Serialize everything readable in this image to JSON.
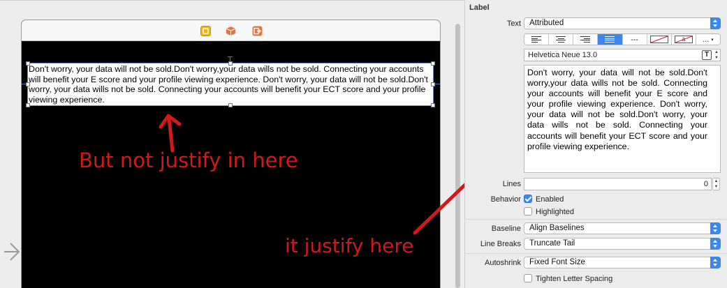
{
  "canvas": {
    "label_text": "Don't worry, your data will not be sold.Don't worry,your data wills not be sold. Connecting your accounts will benefit your E score and your profile viewing experience. Don't worry, your data will not be sold.Don't worry, your data wills not be sold. Connecting your accounts will benefit your ECT score and your profile viewing experience.",
    "annotation_left": "But not justify in here",
    "annotation_right": "it justify here"
  },
  "inspector": {
    "section_title": "Label",
    "text": {
      "label": "Text",
      "value": "Attributed"
    },
    "alignment_segments": [
      {
        "name": "align-left",
        "active": false
      },
      {
        "name": "align-center",
        "active": false
      },
      {
        "name": "align-right",
        "active": false
      },
      {
        "name": "align-justify",
        "active": true
      },
      {
        "name": "align-natural",
        "active": false,
        "glyph": "---"
      },
      {
        "name": "strikethrough",
        "active": false
      },
      {
        "name": "highlight",
        "active": false,
        "glyph": "a"
      },
      {
        "name": "more",
        "active": false,
        "glyph": "..."
      }
    ],
    "font": {
      "value": "Helvetica Neue 13.0",
      "button": "T"
    },
    "attributed_text": "Don't worry, your data will not be sold.Don't worry,your data wills not be sold. Connecting your accounts will benefit your E score and your profile viewing experience. Don't worry, your data will not be sold.Don't worry, your data wills not be sold. Connecting your accounts will benefit your ECT score and your profile viewing experience.",
    "lines": {
      "label": "Lines",
      "value": "0"
    },
    "behavior": {
      "label": "Behavior",
      "enabled": {
        "label": "Enabled",
        "checked": true
      },
      "highlighted": {
        "label": "Highlighted",
        "checked": false
      }
    },
    "baseline": {
      "label": "Baseline",
      "value": "Align Baselines"
    },
    "line_breaks": {
      "label": "Line Breaks",
      "value": "Truncate Tail"
    },
    "autoshrink": {
      "label": "Autoshrink",
      "value": "Fixed Font Size"
    },
    "tighten": {
      "label": "Tighten Letter Spacing",
      "checked": false
    }
  },
  "colors": {
    "annotation_red": "#d0191b",
    "accent_blue": "#3c86f0",
    "scene_background": "#000000"
  }
}
